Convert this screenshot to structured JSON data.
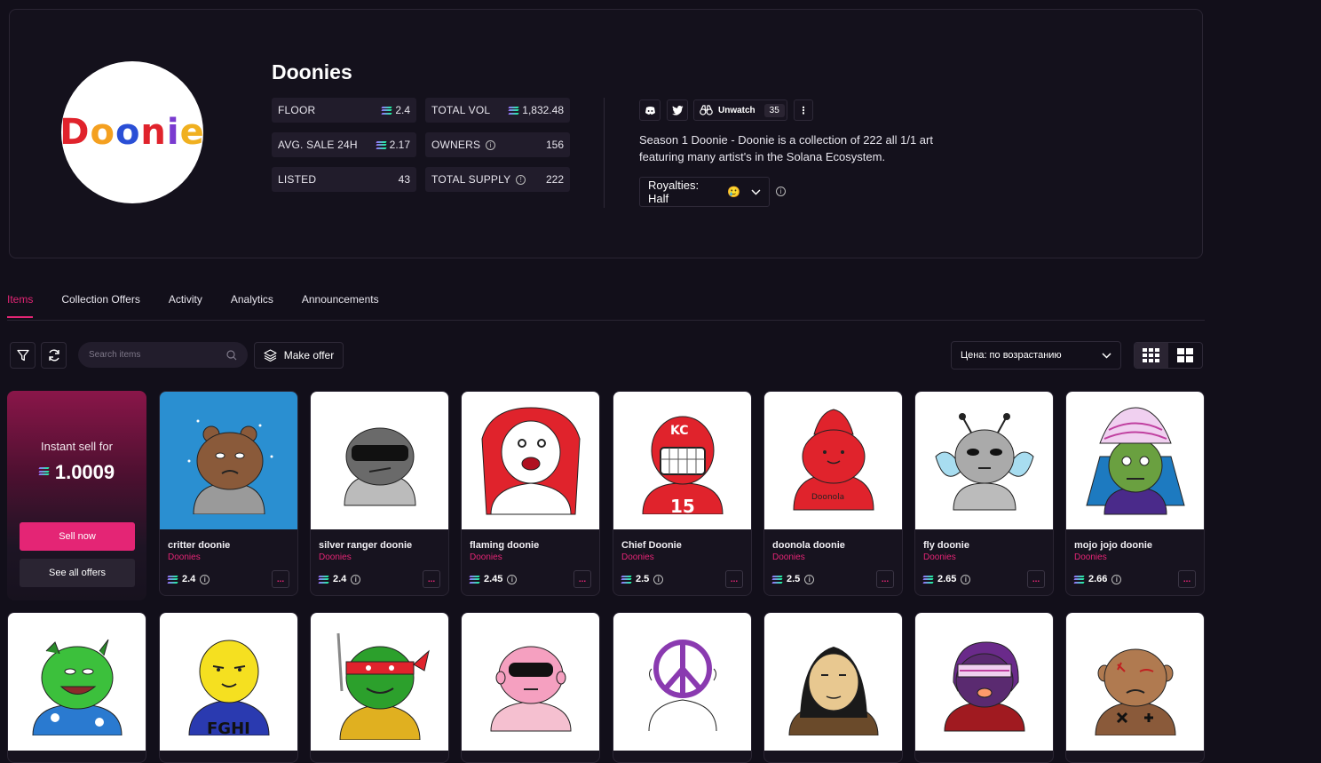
{
  "collection": {
    "logo_text": "Doonie",
    "title": "Doonies",
    "stats": {
      "floor_label": "FLOOR",
      "floor_value": "2.4",
      "total_vol_label": "TOTAL VOL",
      "total_vol_value": "1,832.48",
      "avg_sale_label": "AVG. SALE 24H",
      "avg_sale_value": "2.17",
      "owners_label": "OWNERS",
      "owners_value": "156",
      "listed_label": "LISTED",
      "listed_value": "43",
      "total_supply_label": "TOTAL SUPPLY",
      "total_supply_value": "222"
    },
    "social": {
      "unwatch_label": "Unwatch",
      "watch_count": "35"
    },
    "description": "Season 1 Doonie - Doonie is a collection of 222 all 1/1 art featuring many artist's in the Solana Ecosystem.",
    "royalties_label": "Royalties: Half",
    "royalties_emoji": "🥲"
  },
  "tabs": [
    "Items",
    "Collection Offers",
    "Activity",
    "Analytics",
    "Announcements"
  ],
  "toolbar": {
    "search_placeholder": "Search items",
    "make_offer_label": "Make offer",
    "sort_label": "Цена: по возрастанию"
  },
  "sell_card": {
    "title": "Instant sell for",
    "amount": "1.0009",
    "sell_now_label": "Sell now",
    "see_offers_label": "See all offers"
  },
  "items_row1": [
    {
      "name": "critter doonie",
      "collection": "Doonies",
      "price": "2.4"
    },
    {
      "name": "silver ranger doonie",
      "collection": "Doonies",
      "price": "2.4"
    },
    {
      "name": "flaming doonie",
      "collection": "Doonies",
      "price": "2.45"
    },
    {
      "name": "Chief Doonie",
      "collection": "Doonies",
      "price": "2.5"
    },
    {
      "name": "doonola doonie",
      "collection": "Doonies",
      "price": "2.5"
    },
    {
      "name": "fly doonie",
      "collection": "Doonies",
      "price": "2.65"
    },
    {
      "name": "mojo jojo doonie",
      "collection": "Doonies",
      "price": "2.66"
    }
  ],
  "colors": {
    "accent": "#e42575",
    "background": "#120f1a",
    "card": "#17131f"
  }
}
